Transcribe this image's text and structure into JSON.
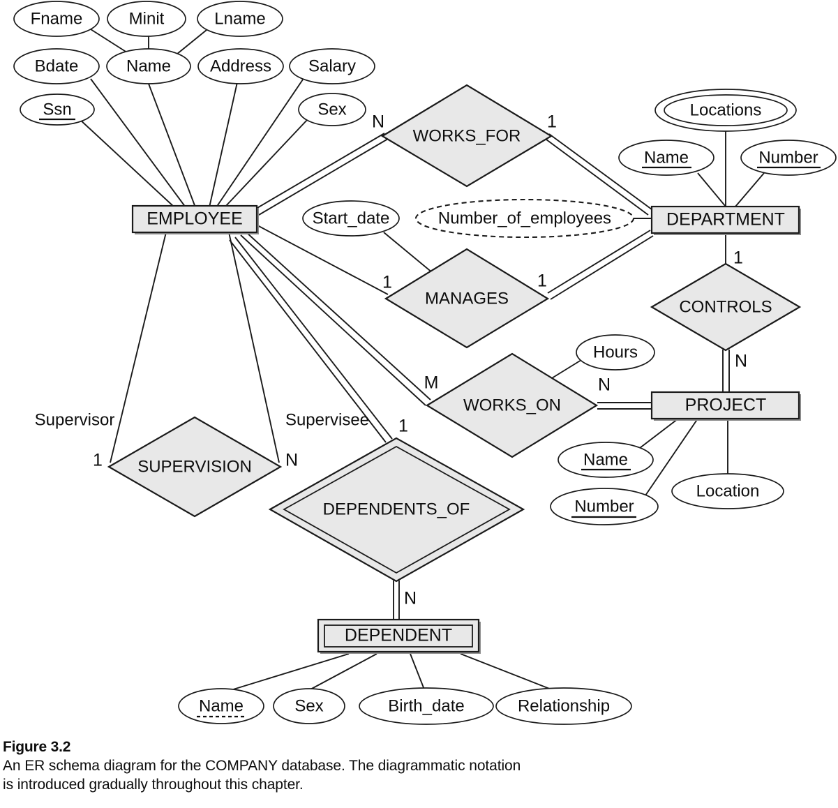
{
  "figure": {
    "title": "Figure 3.2",
    "caption_line1": "An ER schema diagram for the COMPANY database. The diagrammatic notation",
    "caption_line2": "is introduced gradually throughout this chapter."
  },
  "colors": {
    "shape_fill": "#e8e8e8",
    "stroke": "#1a1a1a",
    "background": "#ffffff"
  },
  "diagram": {
    "type": "er-schema",
    "entities": [
      {
        "id": "employee",
        "label": "EMPLOYEE",
        "kind": "strong-entity"
      },
      {
        "id": "department",
        "label": "DEPARTMENT",
        "kind": "strong-entity"
      },
      {
        "id": "project",
        "label": "PROJECT",
        "kind": "strong-entity"
      },
      {
        "id": "dependent",
        "label": "DEPENDENT",
        "kind": "weak-entity"
      }
    ],
    "relationships": [
      {
        "id": "works_for",
        "label": "WORKS_FOR",
        "kind": "relationship"
      },
      {
        "id": "manages",
        "label": "MANAGES",
        "kind": "relationship"
      },
      {
        "id": "works_on",
        "label": "WORKS_ON",
        "kind": "relationship"
      },
      {
        "id": "controls",
        "label": "CONTROLS",
        "kind": "relationship"
      },
      {
        "id": "supervision",
        "label": "SUPERVISION",
        "kind": "relationship"
      },
      {
        "id": "dependents_of",
        "label": "DEPENDENTS_OF",
        "kind": "identifying-relationship"
      }
    ],
    "attributes": {
      "employee": [
        {
          "label": "Fname",
          "kind": "simple"
        },
        {
          "label": "Minit",
          "kind": "simple"
        },
        {
          "label": "Lname",
          "kind": "simple"
        },
        {
          "label": "Name",
          "kind": "composite"
        },
        {
          "label": "Bdate",
          "kind": "simple"
        },
        {
          "label": "Address",
          "kind": "simple"
        },
        {
          "label": "Salary",
          "kind": "simple"
        },
        {
          "label": "Ssn",
          "kind": "key"
        },
        {
          "label": "Sex",
          "kind": "simple"
        }
      ],
      "department": [
        {
          "label": "Name",
          "kind": "key"
        },
        {
          "label": "Number",
          "kind": "key"
        },
        {
          "label": "Locations",
          "kind": "multivalued"
        },
        {
          "label": "Number_of_employees",
          "kind": "derived"
        }
      ],
      "project": [
        {
          "label": "Name",
          "kind": "key"
        },
        {
          "label": "Number",
          "kind": "key"
        },
        {
          "label": "Location",
          "kind": "simple"
        }
      ],
      "dependent": [
        {
          "label": "Name",
          "kind": "partial-key"
        },
        {
          "label": "Sex",
          "kind": "simple"
        },
        {
          "label": "Birth_date",
          "kind": "simple"
        },
        {
          "label": "Relationship",
          "kind": "simple"
        }
      ],
      "manages": [
        {
          "label": "Start_date",
          "kind": "simple"
        }
      ],
      "works_on": [
        {
          "label": "Hours",
          "kind": "simple"
        }
      ]
    },
    "cardinalities": [
      {
        "id": "works_for_employee",
        "value": "N"
      },
      {
        "id": "works_for_department",
        "value": "1"
      },
      {
        "id": "manages_employee",
        "value": "1"
      },
      {
        "id": "manages_department",
        "value": "1"
      },
      {
        "id": "controls_department",
        "value": "1"
      },
      {
        "id": "controls_project",
        "value": "N"
      },
      {
        "id": "works_on_employee",
        "value": "M"
      },
      {
        "id": "works_on_project",
        "value": "N"
      },
      {
        "id": "supervision_supervisor",
        "value": "1"
      },
      {
        "id": "supervision_supervisee",
        "value": "N"
      },
      {
        "id": "dependents_of_employee",
        "value": "1"
      },
      {
        "id": "dependents_of_dependent",
        "value": "N"
      }
    ],
    "roles": [
      {
        "id": "supervisor_role",
        "value": "Supervisor"
      },
      {
        "id": "supervisee_role",
        "value": "Supervisee"
      }
    ]
  }
}
